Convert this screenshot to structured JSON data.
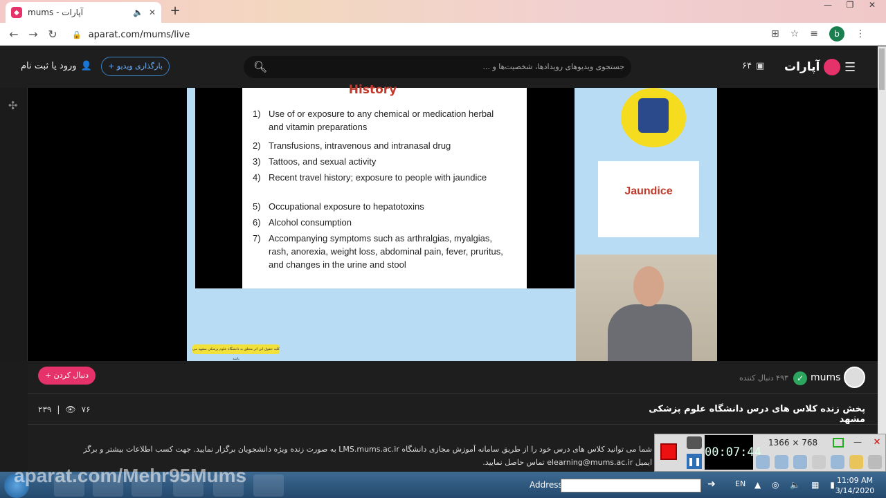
{
  "browser": {
    "tab_title": "آپارات - mums",
    "new_tab": "+",
    "url": "aparat.com/mums/live",
    "profile_initial": "b"
  },
  "header": {
    "logo_text": "آپارات",
    "counter": "۶۴",
    "search_placeholder": "جستجوی ویدیوهای رویدادها، شخصیت‌ها و ...",
    "upload_label": "+ بارگذاری ویدیو",
    "login_label": "ورود یا ثبت نام"
  },
  "slide": {
    "title": "History",
    "items": [
      {
        "n": "1)",
        "text": "Use of or exposure to any chemical or medication herbal and vitamin preparations"
      },
      {
        "n": "2)",
        "text": "Transfusions, intravenous and intranasal drug"
      },
      {
        "n": "3)",
        "text": "Tattoos, and sexual activity"
      },
      {
        "n": "4)",
        "text": "Recent travel history; exposure to people with jaundice"
      },
      {
        "n": "5)",
        "text": "Occupational exposure to hepatotoxins"
      },
      {
        "n": "6)",
        "text": "Alcohol consumption"
      },
      {
        "n": "7)",
        "text": "Accompanying symptoms such as arthralgias, myalgias, rash, anorexia, weight loss, abdominal pain, fever, pruritus, and changes in the urine and stool"
      }
    ],
    "side_label": "Jaundice",
    "notice": "کلیه حقوق این اثر متعلق به دانشگاه علوم پزشکی مشهد می باشد"
  },
  "channel": {
    "name": "mums",
    "followers": "۴۹۳ دنبال کننده",
    "follow_label": "+ دنبال کردن",
    "views": "۷۶",
    "count2": "۲۳۹",
    "separator": "|",
    "title": "پخش زنده کلاس های درس دانشگاه علوم پزشکی مشهد",
    "desc_line1": "شما می توانید کلاس های درس خود را از طریق سامانه آموزش مجازی دانشگاه LMS.mums.ac.ir به صورت زنده ویژه دانشجویان برگزار نمایید. جهت کسب اطلاعات بیشتر و برگزاری کلاس خود به آدرس",
    "desc_line2": "ایمیل elearning@mums.ac.ir تماس حاصل نمایید."
  },
  "recorder": {
    "timer": "00:07:44",
    "resolution": "1366 × 768"
  },
  "taskbar": {
    "watermark": "aparat.com/Mehr95Mums",
    "address_label": "Address",
    "lang": "EN",
    "time": "11:09 AM",
    "date": "3/14/2020"
  }
}
